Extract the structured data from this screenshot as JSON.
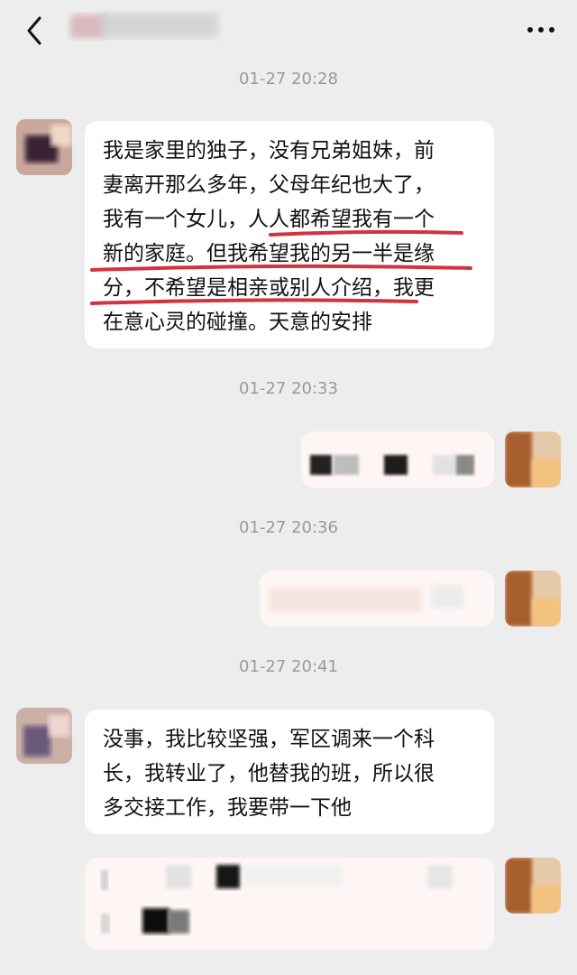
{
  "header": {
    "back_icon": "chevron-left-icon",
    "more_icon": "ellipsis-icon"
  },
  "timestamps": [
    "01-27 20:28",
    "01-27 20:33",
    "01-27 20:36",
    "01-27 20:41"
  ],
  "messages": [
    {
      "side": "incoming",
      "lines": [
        "我是家里的独子，没有兄弟姐妹，前",
        "妻离开那么多年，父母年纪也大了，",
        "我有一个女儿，人人都希望我有一个",
        "新的家庭。但我希望我的另一半是缘",
        "分，不希望是相亲或别人介绍，我更",
        "在意心灵的碰撞。天意的安排"
      ],
      "underline_color": "#d3323f"
    },
    {
      "side": "incoming",
      "lines": [
        "没事，我比较坚强，军区调来一个科",
        "长，我转业了，他替我的班，所以很",
        "多交接工作，我要带一下他"
      ]
    }
  ],
  "colors": {
    "background": "#ededed",
    "bubble_in": "#ffffff",
    "bubble_out": "#fdf6f4",
    "timestamp": "#9a9a9a",
    "underline": "#d3323f"
  }
}
